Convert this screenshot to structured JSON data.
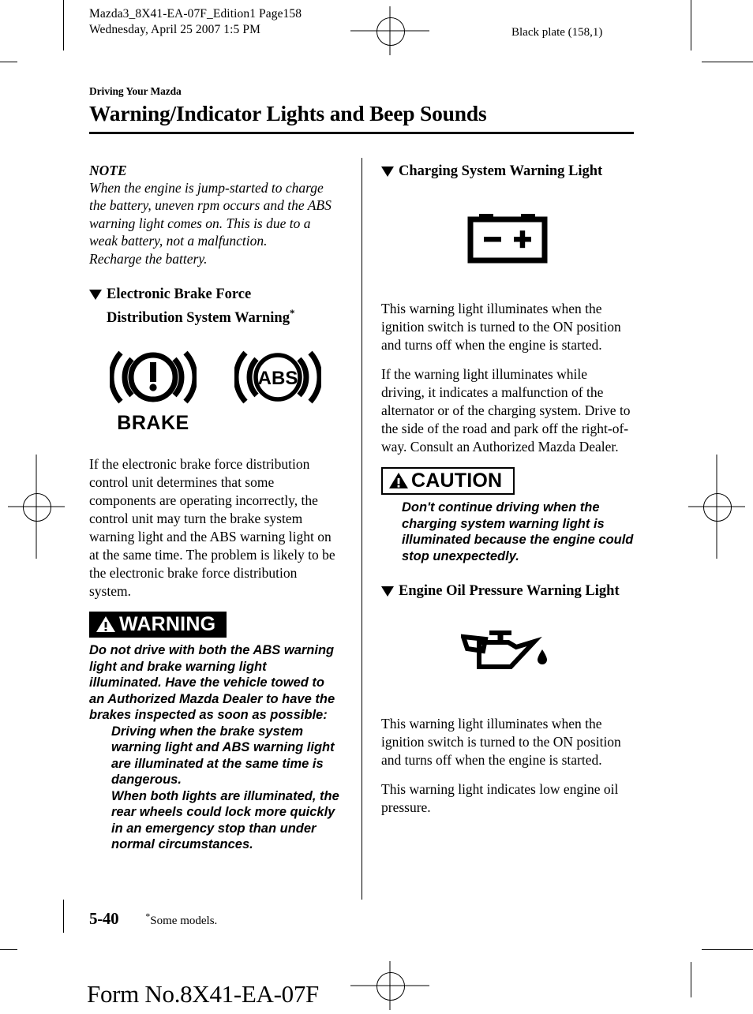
{
  "header": {
    "line1": "Mazda3_8X41-EA-07F_Edition1 Page158",
    "line2": "Wednesday, April 25 2007 1:5 PM",
    "black_plate": "Black plate (158,1)"
  },
  "page": {
    "chapter_label": "Driving Your Mazda",
    "title": "Warning/Indicator Lights and Beep Sounds"
  },
  "left_column": {
    "note": {
      "heading": "NOTE",
      "body": "When the engine is jump-started to charge the battery, uneven rpm occurs and the ABS warning light comes on. This is due to a weak battery, not a malfunction.",
      "body2": "Recharge the battery."
    },
    "section": {
      "heading_line1": "Electronic Brake Force",
      "heading_line2": "Distribution System Warning",
      "heading_star": "*"
    },
    "icons": {
      "brake_label": "BRAKE",
      "abs_label": "ABS"
    },
    "body": "If the electronic brake force distribution control unit determines that some components are operating incorrectly, the control unit may turn the brake system warning light and the ABS warning light on at the same time. The problem is likely to be the electronic brake force distribution system.",
    "warning": {
      "banner_label": "WARNING",
      "body": "Do not drive with both the ABS warning light and brake warning light illuminated. Have the vehicle towed to an Authorized Mazda Dealer to have the brakes inspected as soon as possible:",
      "bullets": [
        "Driving when the brake system warning light and ABS warning light are illuminated at the same time is dangerous.",
        "When both lights are illuminated, the rear wheels could lock more quickly in an emergency stop than under normal circumstances."
      ]
    }
  },
  "right_column": {
    "charging": {
      "heading": "Charging System Warning Light",
      "icon_minus": "−",
      "icon_plus": "+",
      "body1": "This warning light illuminates when the ignition switch is turned to the ON position and turns off when the engine is started.",
      "body2": "If the warning light illuminates while driving, it indicates a malfunction of the alternator or of the charging system. Drive to the side of the road and park off the right-of-way. Consult an Authorized Mazda Dealer."
    },
    "caution": {
      "banner_label": "CAUTION",
      "body": "Don't continue driving when the charging system warning light is illuminated because the engine could stop unexpectedly."
    },
    "oil": {
      "heading": "Engine Oil Pressure Warning Light",
      "body1": "This warning light illuminates when the ignition switch is turned to the ON position and turns off when the engine is started.",
      "body2": "This warning light indicates low engine oil pressure."
    }
  },
  "footer": {
    "page_number": "5-40",
    "footnote_star": "*",
    "footnote_text": "Some models.",
    "form_number": "Form No.8X41-EA-07F"
  }
}
